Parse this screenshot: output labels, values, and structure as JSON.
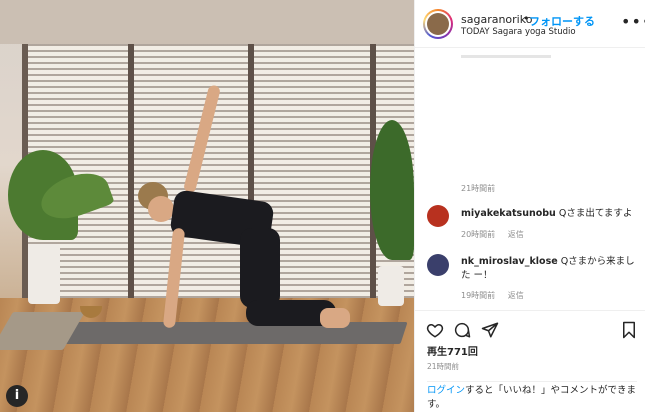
{
  "post": {
    "username": "sagaranoriko",
    "separator": "•",
    "follow_label": "フォローする",
    "location": "TODAY Sagara yoga Studio",
    "more_icon": "more-options-icon",
    "faded_caption": "",
    "top_time": "21時間前"
  },
  "comments": [
    {
      "user": "miyakekatsunobu",
      "text": "Qさま出てますよ",
      "time": "20時間前",
      "reply_label": "返信",
      "avatar_color": "#b8311f"
    },
    {
      "user": "nk_miroslav_klose",
      "text": "Qさまから来ました ー！",
      "time": "19時間前",
      "reply_label": "返信",
      "avatar_color": "#3a3f6b"
    }
  ],
  "actions": {
    "like_icon": "heart-icon",
    "comment_icon": "comment-icon",
    "share_icon": "share-icon",
    "save_icon": "bookmark-icon",
    "plays": "再生771回",
    "time": "21時間前"
  },
  "login": {
    "link_text": "ログイン",
    "rest_text": "すると「いいね！」やコメントができます。"
  },
  "media": {
    "info_badge": "i"
  },
  "colors": {
    "accent": "#0095f6",
    "text": "#262626",
    "muted": "#8e8e8e"
  }
}
